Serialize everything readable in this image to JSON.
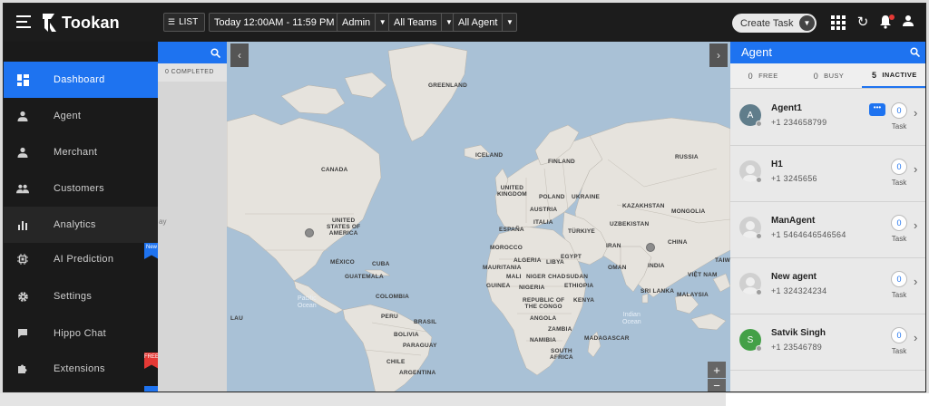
{
  "app": {
    "logo_text": "Tookan"
  },
  "topbar": {
    "list_label": "LIST",
    "date_range": "Today 12:00AM - 11:59 PM",
    "admin_filter": "Admin",
    "teams_filter": "All Teams",
    "agent_filter": "All Agent",
    "create_task": "Create Task"
  },
  "sidebar": {
    "items": [
      {
        "label": "Dashboard",
        "icon": "dashboard-icon",
        "active": true
      },
      {
        "label": "Agent",
        "icon": "person-icon"
      },
      {
        "label": "Merchant",
        "icon": "person-icon"
      },
      {
        "label": "Customers",
        "icon": "group-icon"
      },
      {
        "label": "Analytics",
        "icon": "bar-chart-icon"
      },
      {
        "label": "AI Prediction",
        "icon": "chip-icon",
        "badge": "New"
      },
      {
        "label": "Settings",
        "icon": "gear-icon"
      },
      {
        "label": "Hippo Chat",
        "icon": "chat-icon"
      },
      {
        "label": "Extensions",
        "icon": "puzzle-icon",
        "badge": "FREE"
      }
    ]
  },
  "task_panel": {
    "completed_label": "0 COMPLETED",
    "partial_text": "ay"
  },
  "map": {
    "labels": {
      "greenland": "GREENLAND",
      "iceland": "ICELAND",
      "canada": "CANADA",
      "finland": "FINLAND",
      "russia": "RUSSIA",
      "uk": "UNITED\nKINGDOM",
      "poland": "POLAND",
      "ukraine": "UKRAINE",
      "austria": "AUSTRIA",
      "italia": "ITALIA",
      "espana": "ESPAÑA",
      "turkiye": "TÜRKIYE",
      "kazakhstan": "KAZAKHSTAN",
      "mongolia": "MONGOLIA",
      "uzbekistan": "UZBEKISTAN",
      "usa": "UNITED\nSTATES OF\nAMERICA",
      "morocco": "MOROCCO",
      "algeria": "ALGERIA",
      "libya": "LIBYA",
      "egypt": "EGYPT",
      "iran": "IRAN",
      "china": "CHINA",
      "india": "INDIA",
      "oman": "OMAN",
      "mexico": "MÉXICO",
      "cuba": "CUBA",
      "guatemala": "GUATEMALA",
      "mauritania": "MAURITANIA",
      "mali": "MALI",
      "niger": "NIGER",
      "chad": "CHAD",
      "sudan": "SUDAN",
      "guinea": "GUINEA",
      "nigeria": "NIGERIA",
      "ethiopia": "ETHIOPIA",
      "kenya": "KENYA",
      "congo": "REPUBLIC OF\nTHE CONGO",
      "colombia": "COLOMBIA",
      "peru": "PERU",
      "brasil": "BRASIL",
      "bolivia": "BOLIVIA",
      "paraguay": "PARAGUAY",
      "chile": "CHILE",
      "argentina": "ARGENTINA",
      "angola": "ANGOLA",
      "zambia": "ZAMBIA",
      "namibia": "NAMIBIA",
      "south_africa": "SOUTH\nAFRICA",
      "madagascar": "MADAGASCAR",
      "sri_lanka": "SRI LANKA",
      "malaysia": "MALAYSIA",
      "vietnam": "VIỆT NAM",
      "taiwan": "TAIW",
      "lau": "LAU"
    },
    "pacific": "Pacific\nOcean",
    "indian": "Indian\nOcean",
    "zoom_in": "+",
    "zoom_out": "−"
  },
  "agent_panel": {
    "title": "Agent",
    "tabs": [
      {
        "count": "0",
        "label": "FREE"
      },
      {
        "count": "0",
        "label": "BUSY"
      },
      {
        "count": "5",
        "label": "INACTIVE",
        "active": true
      }
    ],
    "task_label": "Task",
    "agents": [
      {
        "name": "Agent1",
        "phone": "+1 234658799",
        "tasks": "0",
        "initial": "A",
        "avatar_color": "#607d8b",
        "chat": true
      },
      {
        "name": "H1",
        "phone": "+1 3245656",
        "tasks": "0",
        "initial": "",
        "avatar_color": "#d0d0d0"
      },
      {
        "name": "ManAgent",
        "phone": "+1 5464646546564",
        "tasks": "0",
        "initial": "",
        "avatar_color": "#d0d0d0"
      },
      {
        "name": "New agent",
        "phone": "+1 324324234",
        "tasks": "0",
        "initial": "",
        "avatar_color": "#d0d0d0"
      },
      {
        "name": "Satvik Singh",
        "phone": "+1 23546789",
        "tasks": "0",
        "initial": "S",
        "avatar_color": "#43a047"
      }
    ]
  },
  "colors": {
    "accent": "#1e73f0",
    "topbar": "#1c1c1c",
    "sidebar": "#1a1a1a",
    "ocean": "#a9c1d6",
    "land": "#e6e3dd"
  }
}
